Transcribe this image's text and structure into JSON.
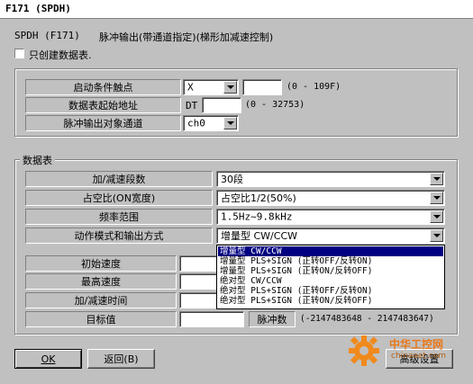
{
  "window": {
    "title": "F171 (SPDH)"
  },
  "header": {
    "code": "SPDH (F171)",
    "description": "脉冲输出(带通道指定)(梯形加减速控制)"
  },
  "checkbox": {
    "label": "只创建数据表.",
    "checked": false
  },
  "top_section": {
    "rows": [
      {
        "label": "启动条件触点",
        "select_value": "X",
        "range": "(0 - 109F)"
      },
      {
        "label": "数据表起始地址",
        "prefix": "DT",
        "range": "(0 - 32753)"
      },
      {
        "label": "脉冲输出对象通道",
        "select_value": "ch0"
      }
    ]
  },
  "data_table": {
    "title": "数据表",
    "rows": [
      {
        "label": "加/减速段数",
        "value": "30段"
      },
      {
        "label": "占空比(ON宽度)",
        "value": "占空比1/2(50%)"
      },
      {
        "label": "频率范围",
        "value": "1.5Hz~9.8kHz"
      },
      {
        "label": "动作模式和输出方式",
        "value": "增量型 CW/CCW"
      },
      {
        "label": "初始速度"
      },
      {
        "label": "最高速度"
      },
      {
        "label": "加/减速时间"
      },
      {
        "label": "目标值",
        "unit": "脉冲数",
        "range": "(-2147483648 - 2147483647)"
      }
    ],
    "dropdown_options": [
      "增量型 CW/CCW",
      "增量型 PLS+SIGN (正转OFF/反转ON)",
      "增量型 PLS+SIGN (正转ON/反转OFF)",
      "绝对型 CW/CCW",
      "绝对型 PLS+SIGN (正转OFF/反转ON)",
      "绝对型 PLS+SIGN (正转ON/反转OFF)"
    ]
  },
  "buttons": {
    "ok": "OK",
    "back": "返回(B)",
    "settings": "高级设置"
  },
  "watermark": {
    "text": "中华工控网",
    "subtext": "chinaaet.com"
  }
}
